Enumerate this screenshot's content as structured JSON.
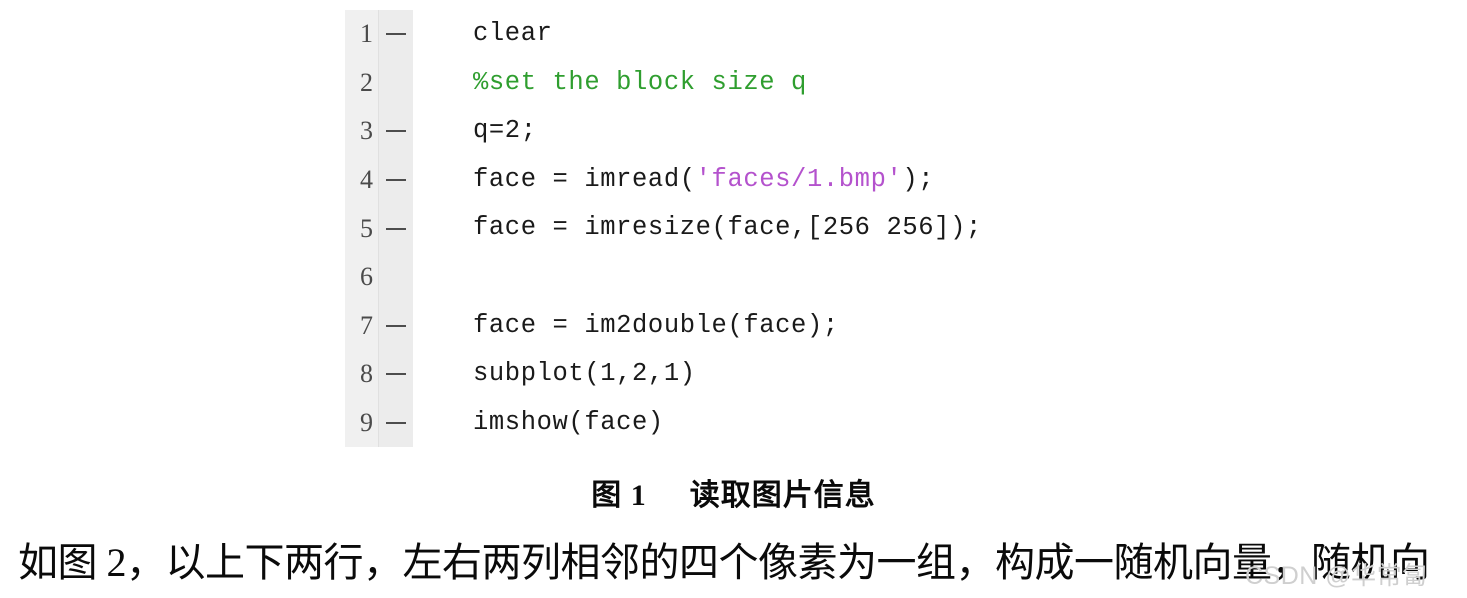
{
  "document": {
    "language": "MATLAB",
    "background_color": "#ffffff",
    "text_color": "#0a0a0a"
  },
  "code_listing": {
    "gutter_background": "#f0f0f0",
    "comment_color": "#2f9e2f",
    "string_color": "#b452cd",
    "code_color": "#1a1a1a",
    "lines": [
      {
        "number": "1",
        "marker": "—",
        "has_marker": true,
        "text": "clear",
        "tokens": [
          {
            "t": "clear",
            "k": "plain"
          }
        ]
      },
      {
        "number": "2",
        "marker": "",
        "has_marker": false,
        "text": "%set the block size q",
        "tokens": [
          {
            "t": "%set the block size q",
            "k": "comment"
          }
        ]
      },
      {
        "number": "3",
        "marker": "—",
        "has_marker": true,
        "text": "q=2;",
        "tokens": [
          {
            "t": "q=2;",
            "k": "plain"
          }
        ]
      },
      {
        "number": "4",
        "marker": "—",
        "has_marker": true,
        "text": "face = imread('faces/1.bmp');",
        "tokens": [
          {
            "t": "face = imread(",
            "k": "plain"
          },
          {
            "t": "'faces/1.bmp'",
            "k": "string"
          },
          {
            "t": ");",
            "k": "plain"
          }
        ]
      },
      {
        "number": "5",
        "marker": "—",
        "has_marker": true,
        "text": "face = imresize(face,[256 256]);",
        "tokens": [
          {
            "t": "face = imresize(face,[256 256]);",
            "k": "plain"
          }
        ]
      },
      {
        "number": "6",
        "marker": "",
        "has_marker": false,
        "text": "",
        "tokens": [
          {
            "t": "",
            "k": "plain"
          }
        ]
      },
      {
        "number": "7",
        "marker": "—",
        "has_marker": true,
        "text": "face = im2double(face);",
        "tokens": [
          {
            "t": "face = im2double(face);",
            "k": "plain"
          }
        ]
      },
      {
        "number": "8",
        "marker": "—",
        "has_marker": true,
        "text": "subplot(1,2,1)",
        "tokens": [
          {
            "t": "subplot(1,2,1)",
            "k": "plain"
          }
        ]
      },
      {
        "number": "9",
        "marker": "—",
        "has_marker": true,
        "text": "imshow(face)",
        "tokens": [
          {
            "t": "imshow(face)",
            "k": "plain"
          }
        ]
      }
    ]
  },
  "caption": {
    "label": "图 1",
    "title": "读取图片信息"
  },
  "paragraph": {
    "text": "如图 2，以上下两行，左右两列相邻的四个像素为一组，构成一随机向量，随机向"
  },
  "watermark": {
    "text": "CSDN @华常匐"
  }
}
